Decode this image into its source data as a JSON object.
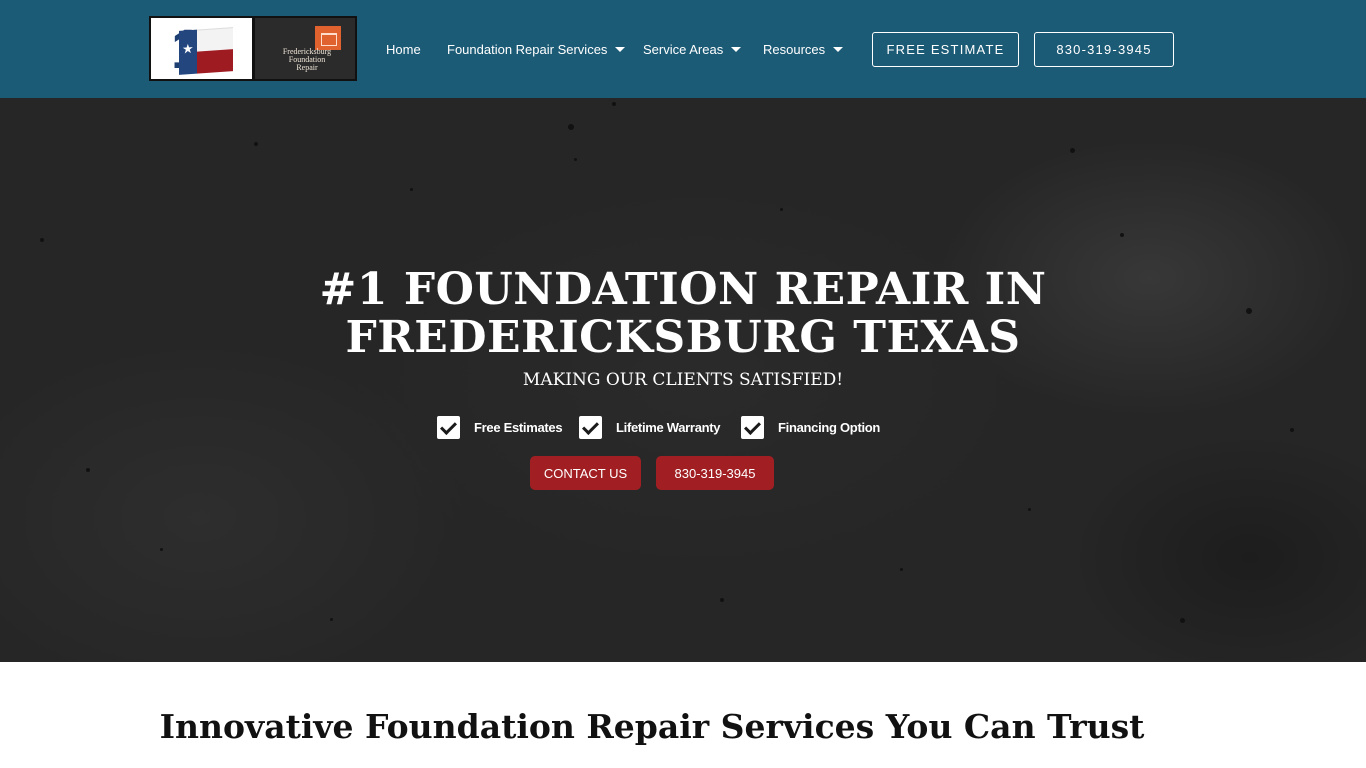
{
  "header": {
    "logo": {
      "flag_number": "1",
      "brand_lines": [
        "Fredericksburg",
        "Foundation",
        "Repair"
      ]
    },
    "nav": [
      {
        "label": "Home",
        "has_dropdown": false
      },
      {
        "label": "Foundation Repair Services",
        "has_dropdown": true
      },
      {
        "label": "Service Areas",
        "has_dropdown": true
      },
      {
        "label": "Resources",
        "has_dropdown": true
      }
    ],
    "estimate_button": "FREE ESTIMATE",
    "phone_button": "830-319-3945"
  },
  "hero": {
    "title_line1": "#1 FOUNDATION REPAIR IN",
    "title_line2": "FREDERICKSBURG TEXAS",
    "subtitle": "MAKING OUR CLIENTS SATISFIED!",
    "features": [
      "Free Estimates",
      "Lifetime Warranty",
      "Financing Option"
    ],
    "contact_button": "CONTACT US",
    "phone_button": "830-319-3945"
  },
  "section": {
    "title": "Innovative Foundation Repair Services You Can Trust"
  },
  "colors": {
    "header_bg": "#1c5b76",
    "hero_bg": "#262626",
    "accent_red": "#a11f23",
    "text_dark": "#111111"
  },
  "icons": {
    "feature_icon": "checkbox-checked-icon",
    "dropdown_icon": "caret-down-icon"
  }
}
